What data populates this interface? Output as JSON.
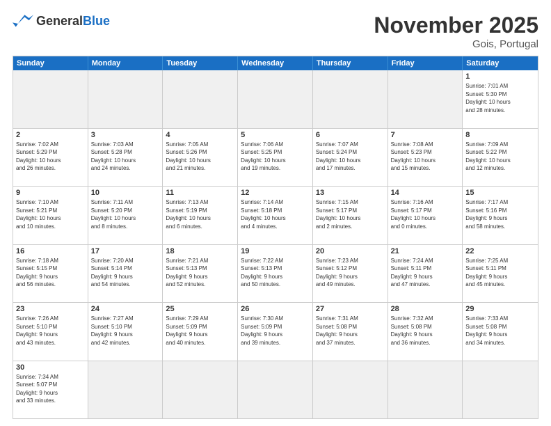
{
  "header": {
    "logo_general": "General",
    "logo_blue": "Blue",
    "month_title": "November 2025",
    "location": "Gois, Portugal"
  },
  "weekdays": [
    "Sunday",
    "Monday",
    "Tuesday",
    "Wednesday",
    "Thursday",
    "Friday",
    "Saturday"
  ],
  "rows": [
    [
      {
        "day": "",
        "info": ""
      },
      {
        "day": "",
        "info": ""
      },
      {
        "day": "",
        "info": ""
      },
      {
        "day": "",
        "info": ""
      },
      {
        "day": "",
        "info": ""
      },
      {
        "day": "",
        "info": ""
      },
      {
        "day": "1",
        "info": "Sunrise: 7:01 AM\nSunset: 5:30 PM\nDaylight: 10 hours\nand 28 minutes."
      }
    ],
    [
      {
        "day": "2",
        "info": "Sunrise: 7:02 AM\nSunset: 5:29 PM\nDaylight: 10 hours\nand 26 minutes."
      },
      {
        "day": "3",
        "info": "Sunrise: 7:03 AM\nSunset: 5:28 PM\nDaylight: 10 hours\nand 24 minutes."
      },
      {
        "day": "4",
        "info": "Sunrise: 7:05 AM\nSunset: 5:26 PM\nDaylight: 10 hours\nand 21 minutes."
      },
      {
        "day": "5",
        "info": "Sunrise: 7:06 AM\nSunset: 5:25 PM\nDaylight: 10 hours\nand 19 minutes."
      },
      {
        "day": "6",
        "info": "Sunrise: 7:07 AM\nSunset: 5:24 PM\nDaylight: 10 hours\nand 17 minutes."
      },
      {
        "day": "7",
        "info": "Sunrise: 7:08 AM\nSunset: 5:23 PM\nDaylight: 10 hours\nand 15 minutes."
      },
      {
        "day": "8",
        "info": "Sunrise: 7:09 AM\nSunset: 5:22 PM\nDaylight: 10 hours\nand 12 minutes."
      }
    ],
    [
      {
        "day": "9",
        "info": "Sunrise: 7:10 AM\nSunset: 5:21 PM\nDaylight: 10 hours\nand 10 minutes."
      },
      {
        "day": "10",
        "info": "Sunrise: 7:11 AM\nSunset: 5:20 PM\nDaylight: 10 hours\nand 8 minutes."
      },
      {
        "day": "11",
        "info": "Sunrise: 7:13 AM\nSunset: 5:19 PM\nDaylight: 10 hours\nand 6 minutes."
      },
      {
        "day": "12",
        "info": "Sunrise: 7:14 AM\nSunset: 5:18 PM\nDaylight: 10 hours\nand 4 minutes."
      },
      {
        "day": "13",
        "info": "Sunrise: 7:15 AM\nSunset: 5:17 PM\nDaylight: 10 hours\nand 2 minutes."
      },
      {
        "day": "14",
        "info": "Sunrise: 7:16 AM\nSunset: 5:17 PM\nDaylight: 10 hours\nand 0 minutes."
      },
      {
        "day": "15",
        "info": "Sunrise: 7:17 AM\nSunset: 5:16 PM\nDaylight: 9 hours\nand 58 minutes."
      }
    ],
    [
      {
        "day": "16",
        "info": "Sunrise: 7:18 AM\nSunset: 5:15 PM\nDaylight: 9 hours\nand 56 minutes."
      },
      {
        "day": "17",
        "info": "Sunrise: 7:20 AM\nSunset: 5:14 PM\nDaylight: 9 hours\nand 54 minutes."
      },
      {
        "day": "18",
        "info": "Sunrise: 7:21 AM\nSunset: 5:13 PM\nDaylight: 9 hours\nand 52 minutes."
      },
      {
        "day": "19",
        "info": "Sunrise: 7:22 AM\nSunset: 5:13 PM\nDaylight: 9 hours\nand 50 minutes."
      },
      {
        "day": "20",
        "info": "Sunrise: 7:23 AM\nSunset: 5:12 PM\nDaylight: 9 hours\nand 49 minutes."
      },
      {
        "day": "21",
        "info": "Sunrise: 7:24 AM\nSunset: 5:11 PM\nDaylight: 9 hours\nand 47 minutes."
      },
      {
        "day": "22",
        "info": "Sunrise: 7:25 AM\nSunset: 5:11 PM\nDaylight: 9 hours\nand 45 minutes."
      }
    ],
    [
      {
        "day": "23",
        "info": "Sunrise: 7:26 AM\nSunset: 5:10 PM\nDaylight: 9 hours\nand 43 minutes."
      },
      {
        "day": "24",
        "info": "Sunrise: 7:27 AM\nSunset: 5:10 PM\nDaylight: 9 hours\nand 42 minutes."
      },
      {
        "day": "25",
        "info": "Sunrise: 7:29 AM\nSunset: 5:09 PM\nDaylight: 9 hours\nand 40 minutes."
      },
      {
        "day": "26",
        "info": "Sunrise: 7:30 AM\nSunset: 5:09 PM\nDaylight: 9 hours\nand 39 minutes."
      },
      {
        "day": "27",
        "info": "Sunrise: 7:31 AM\nSunset: 5:08 PM\nDaylight: 9 hours\nand 37 minutes."
      },
      {
        "day": "28",
        "info": "Sunrise: 7:32 AM\nSunset: 5:08 PM\nDaylight: 9 hours\nand 36 minutes."
      },
      {
        "day": "29",
        "info": "Sunrise: 7:33 AM\nSunset: 5:08 PM\nDaylight: 9 hours\nand 34 minutes."
      }
    ],
    [
      {
        "day": "30",
        "info": "Sunrise: 7:34 AM\nSunset: 5:07 PM\nDaylight: 9 hours\nand 33 minutes."
      },
      {
        "day": "",
        "info": ""
      },
      {
        "day": "",
        "info": ""
      },
      {
        "day": "",
        "info": ""
      },
      {
        "day": "",
        "info": ""
      },
      {
        "day": "",
        "info": ""
      },
      {
        "day": "",
        "info": ""
      }
    ]
  ]
}
